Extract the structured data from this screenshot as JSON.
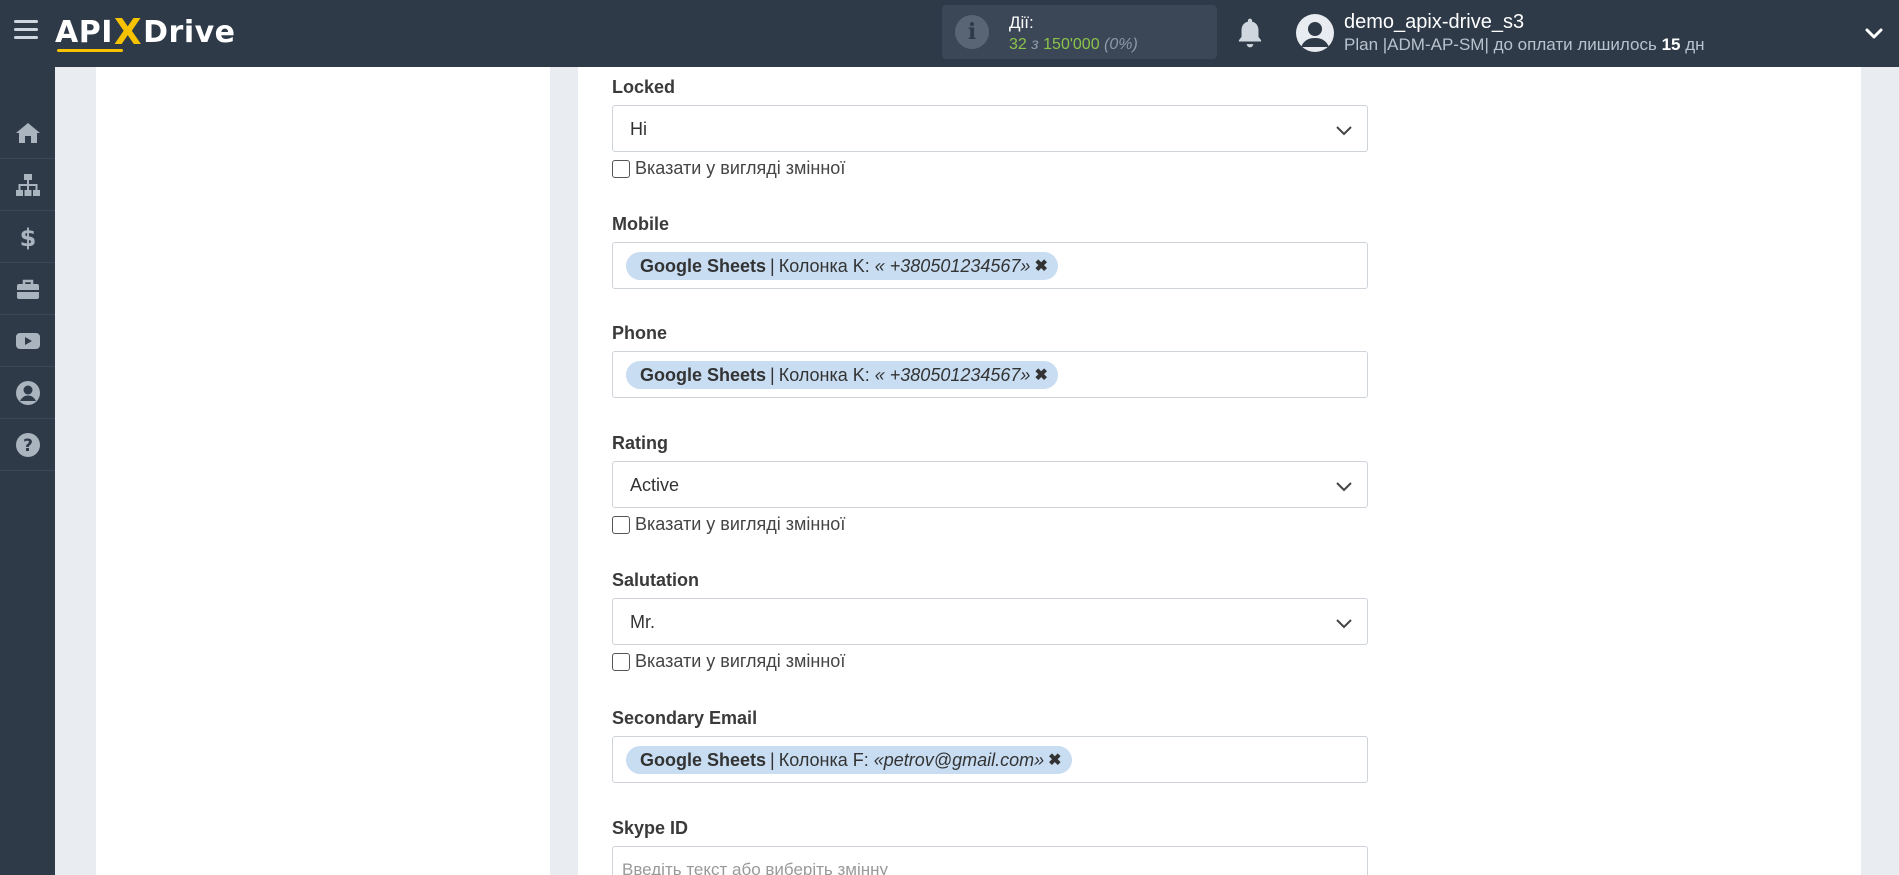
{
  "header": {
    "logo_left": "API",
    "logo_x": "X",
    "logo_right": "Drive",
    "actions_label": "Дії:",
    "actions_used": "32",
    "actions_of": "з",
    "actions_total": "150'000",
    "actions_percent": "(0%)",
    "username": "demo_apix-drive_s3",
    "plan_prefix": "Plan |ADM-AP-SM| до оплати лишилось",
    "plan_days": "15",
    "plan_suffix": "дн"
  },
  "sidebar": {
    "items": [
      {
        "icon": "home-icon"
      },
      {
        "icon": "sitemap-icon"
      },
      {
        "icon": "dollar-icon"
      },
      {
        "icon": "briefcase-icon"
      },
      {
        "icon": "youtube-icon"
      },
      {
        "icon": "user-circle-icon"
      },
      {
        "icon": "question-icon"
      }
    ]
  },
  "form": {
    "locked": {
      "label": "Locked",
      "value": "Ні",
      "checkbox_label": "Вказати у вигляді змінної"
    },
    "mobile": {
      "label": "Mobile",
      "tag_source": "Google Sheets",
      "tag_sep": "|",
      "tag_column": "Колонка K:",
      "tag_sample": "« +380501234567»",
      "tag_remove": "✖"
    },
    "phone": {
      "label": "Phone",
      "tag_source": "Google Sheets",
      "tag_sep": "|",
      "tag_column": "Колонка K:",
      "tag_sample": "« +380501234567»",
      "tag_remove": "✖"
    },
    "rating": {
      "label": "Rating",
      "value": "Active",
      "checkbox_label": "Вказати у вигляді змінної"
    },
    "salutation": {
      "label": "Salutation",
      "value": "Mr.",
      "checkbox_label": "Вказати у вигляді змінної"
    },
    "secondary_email": {
      "label": "Secondary Email",
      "tag_source": "Google Sheets",
      "tag_sep": "|",
      "tag_column": "Колонка F:",
      "tag_sample": "«petrov@gmail.com»",
      "tag_remove": "✖"
    },
    "skype": {
      "label": "Skype ID",
      "placeholder": "Введіть текст або виберіть змінну"
    }
  },
  "colors": {
    "topbar": "#2e3a48",
    "accent": "#f7c300",
    "green": "#8bc34a",
    "tag_bg": "#c8ddf2"
  }
}
